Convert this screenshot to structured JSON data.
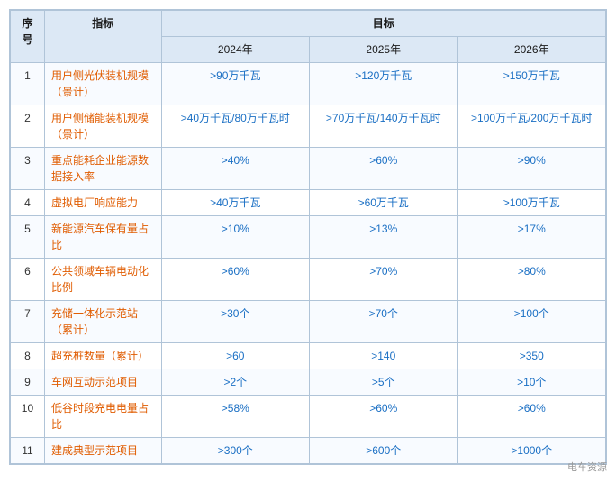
{
  "table": {
    "headers": {
      "row1": [
        "序号",
        "指标",
        "目标",
        "",
        ""
      ],
      "row2": [
        "",
        "",
        "2024年",
        "2025年",
        "2026年"
      ]
    },
    "rows": [
      {
        "num": "1",
        "indicator": "用户侧光伏装机规模（景计）",
        "y2024": ">90万千瓦",
        "y2025": ">120万千瓦",
        "y2026": ">150万千瓦"
      },
      {
        "num": "2",
        "indicator": "用户侧储能装机规模（景计）",
        "y2024": ">40万千瓦/80万千瓦时",
        "y2025": ">70万千瓦/140万千瓦时",
        "y2026": ">100万千瓦/200万千瓦时"
      },
      {
        "num": "3",
        "indicator": "重点能耗企业能源数据接入率",
        "y2024": ">40%",
        "y2025": ">60%",
        "y2026": ">90%"
      },
      {
        "num": "4",
        "indicator": "虚拟电厂响应能力",
        "y2024": ">40万千瓦",
        "y2025": ">60万千瓦",
        "y2026": ">100万千瓦"
      },
      {
        "num": "5",
        "indicator": "新能源汽车保有量占比",
        "y2024": ">10%",
        "y2025": ">13%",
        "y2026": ">17%"
      },
      {
        "num": "6",
        "indicator": "公共领域车辆电动化 比例",
        "y2024": ">60%",
        "y2025": ">70%",
        "y2026": ">80%"
      },
      {
        "num": "7",
        "indicator": "充储一体化示范站（累计）",
        "y2024": ">30个",
        "y2025": ">70个",
        "y2026": ">100个"
      },
      {
        "num": "8",
        "indicator": "超充桩数量（累计）",
        "y2024": ">60",
        "y2025": ">140",
        "y2026": ">350"
      },
      {
        "num": "9",
        "indicator": "车网互动示范项目",
        "y2024": ">2个",
        "y2025": ">5个",
        "y2026": ">10个"
      },
      {
        "num": "10",
        "indicator": "低谷时段充电电量占比",
        "y2024": ">58%",
        "y2025": ">60%",
        "y2026": ">60%"
      },
      {
        "num": "11",
        "indicator": "建成典型示范项目",
        "y2024": ">300个",
        "y2025": ">600个",
        "y2026": ">1000个"
      }
    ],
    "watermark": "电车资源"
  }
}
